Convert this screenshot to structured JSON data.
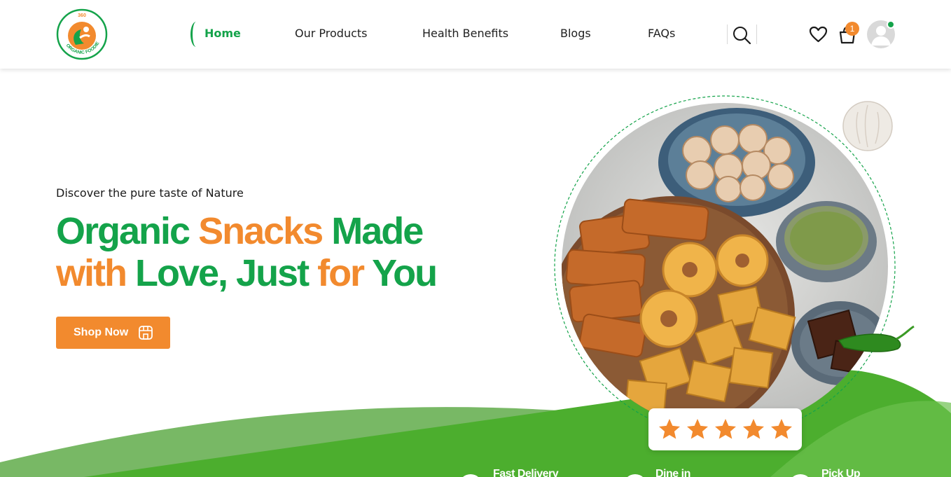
{
  "brand": {
    "logo_top_text": "360",
    "logo_ring_text": "ORGANIC FOODIE",
    "colors": {
      "green": "#14a34a",
      "orange": "#f28a2e",
      "wave_light": "#78b865",
      "wave_dark": "#4cae2e"
    }
  },
  "nav": {
    "items": [
      {
        "label": "Home",
        "active": true
      },
      {
        "label": "Our Products",
        "active": false
      },
      {
        "label": "Health Benefits",
        "active": false
      },
      {
        "label": "Blogs",
        "active": false
      },
      {
        "label": "FAQs",
        "active": false
      }
    ],
    "icons": [
      "search-icon",
      "heart-icon",
      "cart-icon",
      "user-avatar"
    ],
    "cart_count": "1"
  },
  "hero": {
    "tagline": "Discover the pure taste of Nature",
    "headline": {
      "w1": "Organic",
      "w2": "Snacks",
      "w3": "Made",
      "w4": "with",
      "w5": "Love, Just",
      "w6": "for",
      "w7": "You"
    },
    "cta_label": "Shop Now",
    "rating_stars": 5
  },
  "features": [
    {
      "label": "Fast Delivery"
    },
    {
      "label": "Dine in"
    },
    {
      "label": "Pick Up"
    }
  ]
}
